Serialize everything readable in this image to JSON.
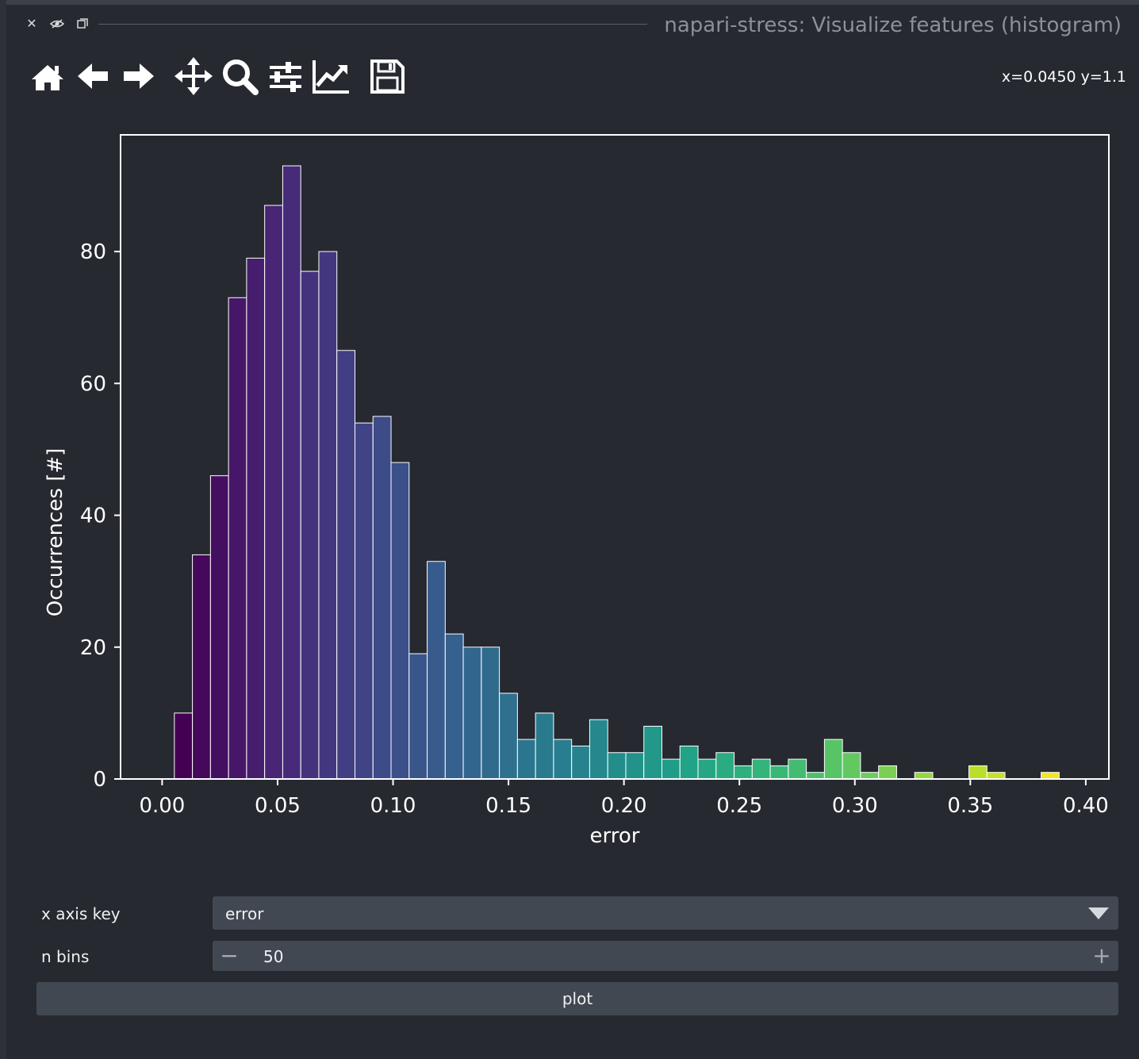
{
  "dock": {
    "title": "napari-stress: Visualize features (histogram)",
    "close_icon": "close-icon",
    "hide_icon": "eye-hidden-icon",
    "float_icon": "float-window-icon"
  },
  "toolbar": {
    "tools": [
      "home-icon",
      "back-arrow-icon",
      "forward-arrow-icon",
      "pan-icon",
      "zoom-icon",
      "configure-subplots-icon",
      "edit-axis-icon",
      "save-icon"
    ],
    "coords": "x=0.0450 y=1.1"
  },
  "chart_data": {
    "type": "bar",
    "subtype": "histogram",
    "xlabel": "error",
    "ylabel": "Occurrences [#]",
    "xlim": [
      -0.018,
      0.41
    ],
    "ylim": [
      0,
      97.7
    ],
    "xticks": [
      0.0,
      0.05,
      0.1,
      0.15,
      0.2,
      0.25,
      0.3,
      0.35,
      0.4
    ],
    "xtick_labels": [
      "0.00",
      "0.05",
      "0.10",
      "0.15",
      "0.20",
      "0.25",
      "0.30",
      "0.35",
      "0.40"
    ],
    "yticks": [
      0,
      20,
      40,
      60,
      80
    ],
    "ytick_labels": [
      "0",
      "20",
      "40",
      "60",
      "80"
    ],
    "colormap": "viridis",
    "bin_start": 0.0053,
    "bin_width": 0.00782,
    "counts": [
      10,
      34,
      46,
      73,
      79,
      87,
      93,
      77,
      80,
      65,
      54,
      55,
      48,
      19,
      33,
      22,
      20,
      20,
      13,
      6,
      10,
      6,
      5,
      9,
      4,
      4,
      8,
      3,
      5,
      3,
      4,
      2,
      3,
      2,
      3,
      1,
      6,
      4,
      1,
      2,
      0,
      1,
      0,
      0,
      2,
      1,
      0,
      0,
      1,
      0
    ],
    "grid": false,
    "background": "#262930",
    "foreground": "#ffffff"
  },
  "form": {
    "xkey_label": "x axis key",
    "xkey_value": "error",
    "nbins_label": "n bins",
    "nbins_value": "50",
    "plot_label": "plot"
  }
}
